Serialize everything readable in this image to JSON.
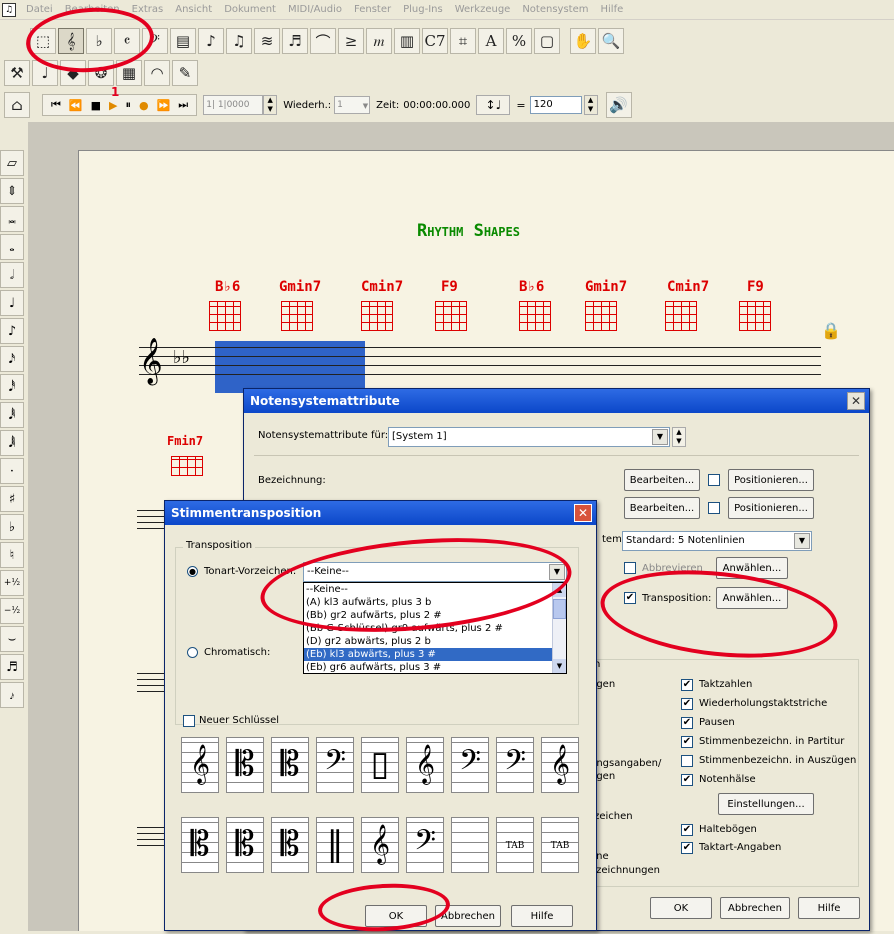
{
  "menu": [
    "Datei",
    "Bearbeiten",
    "Extras",
    "Ansicht",
    "Dokument",
    "MIDI/Audio",
    "Fenster",
    "Plug-Ins",
    "Werkzeuge",
    "Notensystem",
    "Hilfe"
  ],
  "playback": {
    "counter": "1| 1|0000",
    "repeat_label": "Wiederh.:",
    "repeat_value": "1",
    "time_label": "Zeit:",
    "time_value": "00:00:00.000",
    "equals": "=",
    "tempo": "120",
    "annotation_number": "1"
  },
  "score": {
    "title": "Rhythm Shapes",
    "chords_row1": [
      "B♭6",
      "Gmin7",
      "Cmin7",
      "F9",
      "B♭6",
      "Gmin7",
      "Cmin7",
      "F9"
    ],
    "chord_row2": "Fmin7"
  },
  "attrs_dialog": {
    "title": "Notensystemattribute",
    "for_label": "Notensystemattribute für:",
    "for_value": "[System 1]",
    "bez_label": "Bezeichnung:",
    "edit1": "Bearbeiten...",
    "pos1": "Positionieren...",
    "edit2": "Bearbeiten...",
    "pos2": "Positionieren...",
    "system_label_partial": "tem:",
    "system_value": "Standard: 5 Notenlinien",
    "abbrev_label": "Abbrevieren",
    "select1": "Anwählen...",
    "transposition_label": "Transposition:",
    "select2": "Anwählen...",
    "partial_items": [
      "n",
      "ngen",
      "e",
      "ungsangaben/",
      "ngen",
      "rzeichen",
      "ene",
      "ezeichnungen"
    ],
    "checks": [
      {
        "label": "Taktzahlen",
        "checked": "✔"
      },
      {
        "label": "Wiederholungstaktstriche",
        "checked": "✔"
      },
      {
        "label": "Pausen",
        "checked": "✔"
      },
      {
        "label": "Stimmenbezeichn. in Partitur",
        "checked": "✔"
      },
      {
        "label": "Stimmenbezeichn. in Auszügen",
        "checked": ""
      },
      {
        "label": "Notenhälse",
        "checked": "✔"
      }
    ],
    "settings_btn": "Einstellungen...",
    "checks2": [
      {
        "label": "Haltebögen",
        "checked": "✔"
      },
      {
        "label": "Taktart-Angaben",
        "checked": "✔"
      }
    ],
    "ok": "OK",
    "cancel": "Abbrechen",
    "help": "Hilfe"
  },
  "transp_dialog": {
    "title": "Stimmentransposition",
    "group_label": "Transposition",
    "key_label": "Tonart-Vorzeichen:",
    "key_value": "--Keine--",
    "chromatic_label": "Chromatisch:",
    "options": [
      "--Keine--",
      "(A) kl3 aufwärts, plus 3 b",
      "(Bb) gr2 aufwärts, plus 2 #",
      "(Bb  G-Schlüssel) gr9 aufwärts, plus 2 #",
      "(D) gr2 abwärts, plus 2 b",
      "(Eb) kl3 abwärts, plus 3 #",
      "(Eb) gr6 aufwärts, plus 3 #"
    ],
    "selected_index": 5,
    "new_clef_label": "Neuer Schlüssel",
    "clefs_row1": [
      "𝄞",
      "𝄡",
      "𝄡",
      "𝄢",
      "▯",
      "𝄞",
      "𝄢",
      "𝄢",
      "𝄞"
    ],
    "clefs_row2": [
      "𝄡",
      "𝄡",
      "𝄡",
      "‖",
      "𝄞",
      "𝄢",
      "",
      "TAB",
      "TAB"
    ],
    "ok": "OK",
    "cancel": "Abbrechen",
    "help": "Hilfe"
  }
}
